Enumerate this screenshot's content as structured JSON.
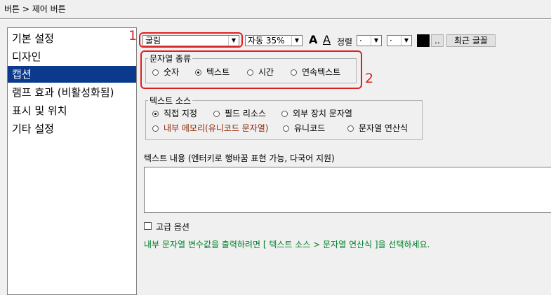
{
  "breadcrumb": "버튼 > 제어 버튼",
  "sidebar": {
    "items": [
      {
        "label": "기본 설정",
        "selected": false
      },
      {
        "label": "디자인",
        "selected": false
      },
      {
        "label": "캡션",
        "selected": true
      },
      {
        "label": "램프 효과 (비활성화됨)",
        "selected": false
      },
      {
        "label": "표시 및 위치",
        "selected": false
      },
      {
        "label": "기타 설정",
        "selected": false
      }
    ]
  },
  "annotations": {
    "marker1": "1",
    "marker2": "2",
    "color": "#e02020"
  },
  "toolbar": {
    "font_select": "굴림",
    "size_select": "자동 35%",
    "bold_glyph": "A",
    "underline_glyph": "A",
    "align_label": "정렬",
    "align_h": "·",
    "align_v": "·",
    "color_swatch": "#000000",
    "ellipsis_label": "..",
    "recent_font_button": "최근 글꼴"
  },
  "string_type": {
    "legend": "문자열 종류",
    "options": [
      {
        "label": "숫자",
        "checked": false
      },
      {
        "label": "텍스트",
        "checked": true
      },
      {
        "label": "시간",
        "checked": false
      },
      {
        "label": "연속텍스트",
        "checked": false
      }
    ]
  },
  "text_source": {
    "legend": "텍스트 소스",
    "options": [
      {
        "label": "직접 지정",
        "checked": true,
        "color": "#000000"
      },
      {
        "label": "필드 리소스",
        "checked": false,
        "color": "#000000"
      },
      {
        "label": "외부 장치 문자열",
        "checked": false,
        "color": "#000000"
      },
      {
        "label": "내부 메모리(유니코드 문자열)",
        "checked": false,
        "color": "#8b2500"
      },
      {
        "label": "유니코드",
        "checked": false,
        "color": "#000000"
      },
      {
        "label": "문자열 연산식",
        "checked": false,
        "color": "#000000"
      }
    ]
  },
  "text_content": {
    "label": "텍스트 내용 (엔터키로 행바꿈 표현 가능, 다국어 지원)",
    "value": ""
  },
  "advanced_option": {
    "label": "고급 옵션",
    "checked": false
  },
  "hint": "내부 문자열 변수값을 출력하려면 [ 텍스트 소스 > 문자열 연산식 ]을 선택하세요.",
  "colors": {
    "hint": "#00802b",
    "selected_bg": "#0b3a8d"
  }
}
